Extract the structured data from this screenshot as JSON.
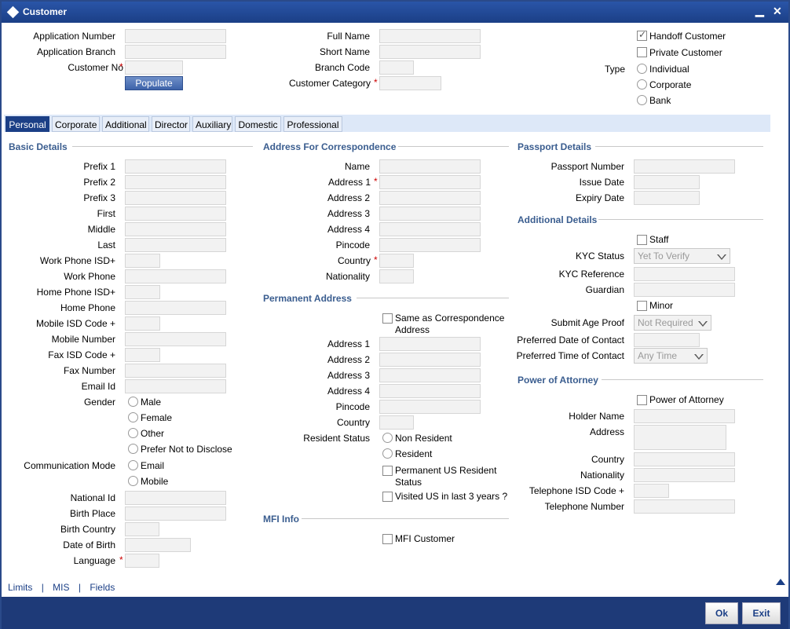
{
  "window": {
    "title": "Customer",
    "minimize": "▁",
    "close": "✕"
  },
  "header": {
    "application_number": "Application Number",
    "application_branch": "Application Branch",
    "customer_no": "Customer No",
    "populate": "Populate",
    "full_name": "Full Name",
    "short_name": "Short Name",
    "branch_code": "Branch Code",
    "customer_category": "Customer Category",
    "handoff_customer": "Handoff Customer",
    "private_customer": "Private Customer",
    "type": "Type",
    "type_options": [
      "Individual",
      "Corporate",
      "Bank"
    ]
  },
  "tabs": [
    "Personal",
    "Corporate",
    "Additional",
    "Director",
    "Auxiliary",
    "Domestic",
    "Professional"
  ],
  "basic": {
    "section": "Basic Details",
    "prefix1": "Prefix 1",
    "prefix2": "Prefix 2",
    "prefix3": "Prefix 3",
    "first": "First",
    "middle": "Middle",
    "last": "Last",
    "work_phone_isd": "Work Phone ISD+",
    "work_phone": "Work Phone",
    "home_phone_isd": "Home Phone ISD+",
    "home_phone": "Home Phone",
    "mobile_isd": "Mobile ISD Code +",
    "mobile_number": "Mobile Number",
    "fax_isd": "Fax ISD Code +",
    "fax_number": "Fax Number",
    "email_id": "Email Id",
    "gender": "Gender",
    "gender_options": [
      "Male",
      "Female",
      "Other",
      "Prefer Not to Disclose"
    ],
    "communication_mode": "Communication Mode",
    "comm_options": [
      "Email",
      "Mobile"
    ],
    "national_id": "National Id",
    "birth_place": "Birth Place",
    "birth_country": "Birth Country",
    "date_of_birth": "Date of Birth",
    "language": "Language"
  },
  "address": {
    "section": "Address For Correspondence",
    "name": "Name",
    "address1": "Address 1",
    "address2": "Address 2",
    "address3": "Address 3",
    "address4": "Address 4",
    "pincode": "Pincode",
    "country": "Country",
    "nationality": "Nationality"
  },
  "permanent": {
    "section": "Permanent Address",
    "same_as_l1": "Same as Correspondence",
    "same_as_l2": "Address",
    "address1": "Address 1",
    "address2": "Address 2",
    "address3": "Address 3",
    "address4": "Address 4",
    "pincode": "Pincode",
    "country": "Country",
    "resident_status": "Resident Status",
    "non_resident": "Non Resident",
    "resident": "Resident",
    "perm_us_l1": "Permanent US Resident",
    "perm_us_l2": "Status",
    "visited_us": "Visited US in last 3 years ?"
  },
  "mfi": {
    "section": "MFI Info",
    "mfi_customer": "MFI Customer"
  },
  "passport": {
    "section": "Passport Details",
    "passport_number": "Passport Number",
    "issue_date": "Issue Date",
    "expiry_date": "Expiry Date"
  },
  "additional": {
    "section": "Additional Details",
    "staff": "Staff",
    "kyc_status": "KYC Status",
    "kyc_status_value": "Yet To Verify",
    "kyc_reference": "KYC Reference",
    "guardian": "Guardian",
    "minor": "Minor",
    "submit_age_proof": "Submit Age Proof",
    "submit_age_proof_value": "Not Required",
    "preferred_date": "Preferred Date of Contact",
    "preferred_time": "Preferred Time of Contact",
    "preferred_time_value": "Any Time"
  },
  "poa": {
    "section": "Power of Attorney",
    "power_of_attorney": "Power of Attorney",
    "holder_name": "Holder Name",
    "address": "Address",
    "country": "Country",
    "nationality": "Nationality",
    "telephone_isd": "Telephone ISD Code +",
    "telephone_number": "Telephone Number"
  },
  "footer": {
    "links": [
      "Limits",
      "|",
      "MIS",
      "|",
      "Fields"
    ],
    "ok": "Ok",
    "exit": "Exit"
  }
}
